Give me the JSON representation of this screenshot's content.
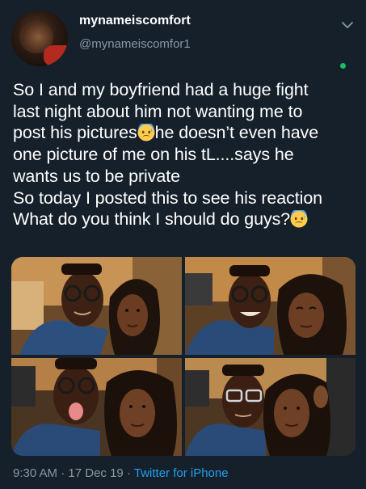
{
  "tweet": {
    "display_name": "mynameiscomfort",
    "handle": "@mynameiscomfor1",
    "text_lines": [
      "So I and my boyfriend had a huge fight",
      "last night about him not wanting me to",
      "post his pictures",
      "he doesn’t even have",
      "one picture of me on his tL....says he",
      "wants us to be private",
      "So today I posted this to see his reaction",
      "What do you think I should do guys?"
    ],
    "emoji": "anxious-face-with-sweat",
    "photos_count": 4,
    "time": "9:30 AM",
    "separator": "·",
    "date": "17 Dec 19",
    "source": "Twitter for iPhone"
  },
  "colors": {
    "background": "#15202b",
    "text": "#ffffff",
    "secondary": "#8899a6",
    "link": "#1da1f2",
    "online": "#17bf63"
  }
}
